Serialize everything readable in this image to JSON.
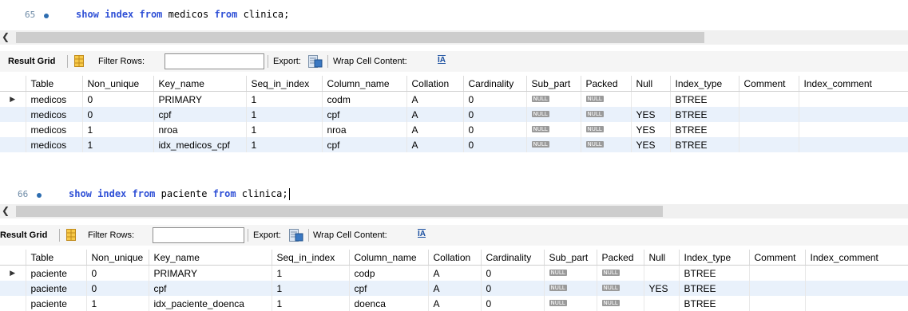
{
  "query1": {
    "line_number": "65",
    "sql_tokens": [
      {
        "text": "show",
        "kw": true
      },
      {
        "text": " ",
        "kw": false
      },
      {
        "text": "index",
        "kw": true
      },
      {
        "text": " ",
        "kw": false
      },
      {
        "text": "from",
        "kw": true
      },
      {
        "text": " medicos ",
        "kw": false
      },
      {
        "text": "from",
        "kw": true
      },
      {
        "text": " clinica;",
        "kw": false
      }
    ],
    "toolbar": {
      "result_grid": "Result Grid",
      "filter_rows": "Filter Rows:",
      "export": "Export:",
      "wrap_cell": "Wrap Cell Content:"
    },
    "columns": [
      "",
      "Table",
      "Non_unique",
      "Key_name",
      "Seq_in_index",
      "Column_name",
      "Collation",
      "Cardinality",
      "Sub_part",
      "Packed",
      "Null",
      "Index_type",
      "Comment",
      "Index_comment"
    ],
    "rows": [
      [
        "medicos",
        "0",
        "PRIMARY",
        "1",
        "codm",
        "A",
        "0",
        "NULL",
        "NULL",
        "",
        "BTREE",
        "",
        ""
      ],
      [
        "medicos",
        "0",
        "cpf",
        "1",
        "cpf",
        "A",
        "0",
        "NULL",
        "NULL",
        "YES",
        "BTREE",
        "",
        ""
      ],
      [
        "medicos",
        "1",
        "nroa",
        "1",
        "nroa",
        "A",
        "0",
        "NULL",
        "NULL",
        "YES",
        "BTREE",
        "",
        ""
      ],
      [
        "medicos",
        "1",
        "idx_medicos_cpf",
        "1",
        "cpf",
        "A",
        "0",
        "NULL",
        "NULL",
        "YES",
        "BTREE",
        "",
        ""
      ]
    ]
  },
  "query2": {
    "line_number": "66",
    "sql_tokens": [
      {
        "text": "show",
        "kw": true
      },
      {
        "text": " ",
        "kw": false
      },
      {
        "text": "index",
        "kw": true
      },
      {
        "text": " ",
        "kw": false
      },
      {
        "text": "from",
        "kw": true
      },
      {
        "text": " paciente ",
        "kw": false
      },
      {
        "text": "from",
        "kw": true
      },
      {
        "text": " clinica;",
        "kw": false
      }
    ],
    "toolbar": {
      "result_grid": "Result Grid",
      "filter_rows": "Filter Rows:",
      "export": "Export:",
      "wrap_cell": "Wrap Cell Content:"
    },
    "columns": [
      "",
      "Table",
      "Non_unique",
      "Key_name",
      "Seq_in_index",
      "Column_name",
      "Collation",
      "Cardinality",
      "Sub_part",
      "Packed",
      "Null",
      "Index_type",
      "Comment",
      "Index_comment"
    ],
    "rows": [
      [
        "paciente",
        "0",
        "PRIMARY",
        "1",
        "codp",
        "A",
        "0",
        "NULL",
        "NULL",
        "",
        "BTREE",
        "",
        ""
      ],
      [
        "paciente",
        "0",
        "cpf",
        "1",
        "cpf",
        "A",
        "0",
        "NULL",
        "NULL",
        "YES",
        "BTREE",
        "",
        ""
      ],
      [
        "paciente",
        "1",
        "idx_paciente_doenca",
        "1",
        "doenca",
        "A",
        "0",
        "NULL",
        "NULL",
        "",
        "BTREE",
        "",
        ""
      ]
    ]
  },
  "colors": {
    "keyword": "#2f50d6",
    "row_alt": "#e9f1fb",
    "null_badge": "#9a9a9a"
  },
  "icons": {
    "grid": "result-grid-icon",
    "export": "export-icon",
    "wrap": "wrap-cell-icon",
    "row_indicator": "row-pointer-icon",
    "scroll_left": "scroll-left-arrow-icon"
  }
}
